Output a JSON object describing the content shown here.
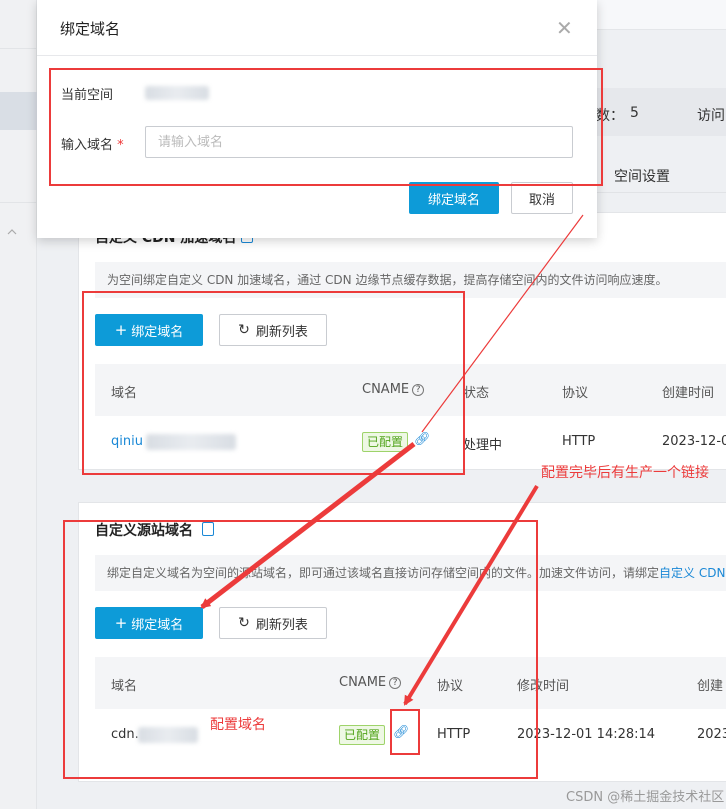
{
  "modal": {
    "title": "绑定域名",
    "current_space_label": "当前空间",
    "domain_label": "输入域名",
    "required_mark": "*",
    "domain_placeholder": "请输入域名",
    "confirm_label": "绑定域名",
    "cancel_label": "取消"
  },
  "header": {
    "stat_label": "数：",
    "stat_value": "5",
    "visit_label": "访问",
    "tab_label": "空间设置"
  },
  "cdn_section": {
    "title": "自定义 CDN 加速域名",
    "description": "为空间绑定自定义 CDN 加速域名，通过 CDN 边缘节点缓存数据，提高存储空间内的文件访问响应速度。",
    "bind_label": "绑定域名",
    "refresh_label": "刷新列表",
    "columns": [
      "域名",
      "CNAME",
      "状态",
      "协议",
      "创建时间"
    ],
    "row": {
      "domain": "qiniu",
      "cname_badge": "已配置",
      "status": "处理中",
      "protocol": "HTTP",
      "created": "2023-12-0"
    }
  },
  "origin_section": {
    "title": "自定义源站域名",
    "description": "绑定自定义域名为空间的源站域名，即可通过该域名直接访问存储空间内的文件。加速文件访问，请绑定",
    "description_link": "自定义 CDN",
    "bind_label": "绑定域名",
    "refresh_label": "刷新列表",
    "columns": [
      "域名",
      "CNAME",
      "协议",
      "修改时间",
      "创建"
    ],
    "row": {
      "domain": "cdn.",
      "cname_badge": "已配置",
      "protocol": "HTTP",
      "modified": "2023-12-01 14:28:14",
      "created": "2023"
    }
  },
  "annotations": {
    "link_note": "配置完毕后有生产一个链接",
    "domain_note": "配置域名",
    "color": "#ec3b3b"
  },
  "watermark": "CSDN @稀土掘金技术社区",
  "icons": {
    "close": "close-icon",
    "plus": "plus-icon",
    "refresh": "refresh-icon",
    "link": "chain-link-icon",
    "help": "question-mark-icon",
    "doc": "document-icon"
  }
}
